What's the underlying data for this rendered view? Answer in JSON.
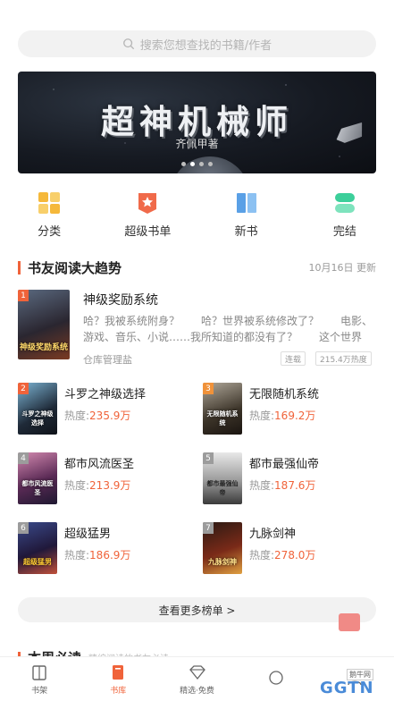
{
  "search": {
    "placeholder": "搜索您想查找的书籍/作者"
  },
  "banner": {
    "title": "超神机械师",
    "author": "齐佩甲著",
    "dots": 4,
    "active_dot": 1
  },
  "categories": [
    {
      "label": "分类",
      "icon": "grid-icon",
      "color": "#f5b83a"
    },
    {
      "label": "超级书单",
      "icon": "badge-star-icon",
      "color": "#f06a4a"
    },
    {
      "label": "新书",
      "icon": "book-open-icon",
      "color": "#5aa0e6"
    },
    {
      "label": "完结",
      "icon": "stack-icon",
      "color": "#3ccf9a"
    }
  ],
  "ranking": {
    "title": "书友阅读大趋势",
    "updated": "10月16日 更新",
    "top": {
      "rank": "1",
      "title": "神级奖励系统",
      "desc": "哈？我被系统附身？　　哈？世界被系统修改了？　　电影、游戏、音乐、小说……我所知道的都没有了？　　这个世界太…",
      "author": "仓库管理盐",
      "tag_status": "连载",
      "tag_heat": "215.4万热度"
    },
    "heat_prefix": "热度:",
    "items": [
      {
        "rank": "2",
        "title": "斗罗之神级选择",
        "heat": "235.9万"
      },
      {
        "rank": "3",
        "title": "无限随机系统",
        "heat": "169.2万"
      },
      {
        "rank": "4",
        "title": "都市风流医圣",
        "heat": "213.9万"
      },
      {
        "rank": "5",
        "title": "都市最强仙帝",
        "heat": "187.6万"
      },
      {
        "rank": "6",
        "title": "超级猛男",
        "heat": "186.9万"
      },
      {
        "rank": "7",
        "title": "九脉剑神",
        "heat": "278.0万"
      }
    ],
    "more_label": "查看更多榜单 >"
  },
  "next_section": {
    "title": "本周必读",
    "subtitle": "精编阅读的书友必读"
  },
  "bottom_nav": [
    {
      "label": "书架",
      "icon": "bookshelf-icon"
    },
    {
      "label": "书库",
      "icon": "library-icon",
      "active": true
    },
    {
      "label": "精选·免费",
      "icon": "diamond-icon"
    },
    {
      "label": "",
      "icon": "find-icon"
    },
    {
      "label": "",
      "icon": "user-icon"
    }
  ],
  "watermark": {
    "text": "GGTN",
    "small": "鹅牛网"
  }
}
